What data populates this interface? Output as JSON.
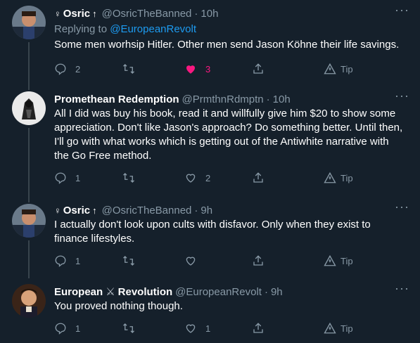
{
  "tweets": [
    {
      "name": "Osric",
      "name_prefix": "♀",
      "name_suffix": "↑",
      "handle": "@OsricTheBanned",
      "time": "10h",
      "reply_label": "Replying to ",
      "reply_handle": "@EuropeanRevolt",
      "text": "Some men worhsip Hitler. Other men send Jason Köhne their life savings.",
      "replies": "2",
      "retweets": "",
      "likes": "3",
      "share": "",
      "tip": "Tip"
    },
    {
      "name": "Promethean Redemption",
      "handle": "@PrmthnRdmptn",
      "time": "10h",
      "text": "All I did was buy his book, read it and willfully give him $20 to show some appreciation. Don't like Jason's approach? Do something better. Until then, I'll go with what works which is getting out of the Antiwhite narrative with the Go Free method.",
      "replies": "1",
      "retweets": "",
      "likes": "2",
      "tip": "Tip"
    },
    {
      "name": "Osric",
      "name_prefix": "♀",
      "name_suffix": "↑",
      "handle": "@OsricTheBanned",
      "time": "9h",
      "text": "I actually don't look upon cults with disfavor. Only when they exist to finance lifestyles.",
      "replies": "1",
      "retweets": "",
      "likes": "",
      "tip": "Tip"
    },
    {
      "name": "European",
      "name_emoji": "⚔",
      "name_tail": "Revolution",
      "handle": "@EuropeanRevolt",
      "time": "9h",
      "text": "You proved nothing though.",
      "replies": "1",
      "retweets": "",
      "likes": "1",
      "tip": "Tip"
    }
  ],
  "separator": "·",
  "colors": {
    "background": "#15202b",
    "text": "#ffffff",
    "muted": "#8899a6",
    "link": "#1d9bf0",
    "like": "#f91880",
    "thread": "#38444d"
  }
}
